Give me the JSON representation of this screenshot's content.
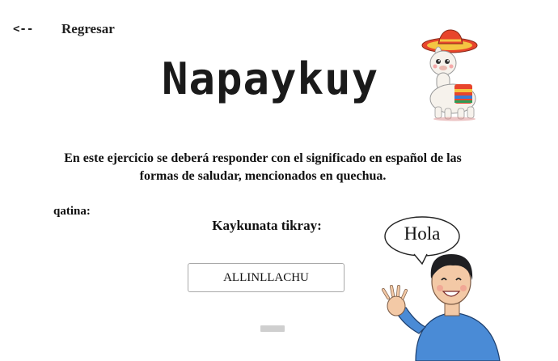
{
  "nav": {
    "back_arrow": "<--",
    "back_label": "Regresar"
  },
  "header": {
    "title": "Napaykuy"
  },
  "instructions": "En este ejercicio se deberá responder con el significado en español de las formas de saludar, mencionados en quechua.",
  "exercise": {
    "field_label": "qatina:",
    "prompt": "Kaykunata tikray:",
    "word": "ALLINLLACHU",
    "answer_value": ""
  },
  "character": {
    "speech": "Hola"
  },
  "colors": {
    "shirt": "#4a8bd6",
    "hat": "#e8452c",
    "accent": "#f4c542"
  },
  "icons": [
    "llama-mascot-icon",
    "character-illustration"
  ]
}
